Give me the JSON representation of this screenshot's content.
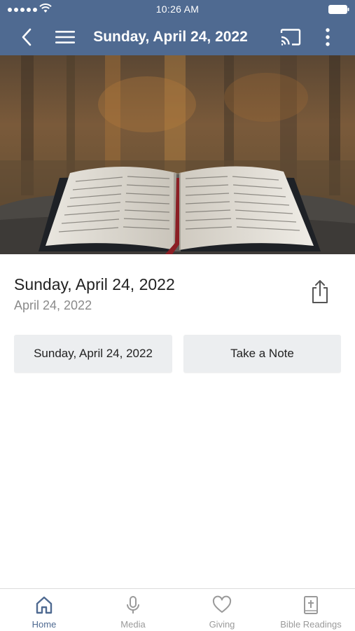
{
  "status_bar": {
    "time": "10:26 AM"
  },
  "nav": {
    "title": "Sunday, April 24, 2022",
    "back_icon": "chevron-left-icon",
    "menu_icon": "hamburger-menu-icon",
    "cast_icon": "cast-icon",
    "more_icon": "vertical-dots-icon"
  },
  "hero": {
    "description_icon": "open-bible-photo"
  },
  "content": {
    "title": "Sunday, April 24, 2022",
    "date": "April 24, 2022",
    "share_icon": "share-icon"
  },
  "actions": [
    {
      "label": "Sunday, April 24, 2022"
    },
    {
      "label": "Take a Note"
    }
  ],
  "tabs": [
    {
      "label": "Home",
      "icon": "home-icon",
      "active": true
    },
    {
      "label": "Media",
      "icon": "microphone-icon",
      "active": false
    },
    {
      "label": "Giving",
      "icon": "heart-icon",
      "active": false
    },
    {
      "label": "Bible Readings",
      "icon": "bible-icon",
      "active": false
    }
  ],
  "colors": {
    "header_bg": "#4f6a91",
    "active_tab": "#4f6a91",
    "inactive_tab": "#9a9a9a",
    "button_bg": "#eceef0"
  }
}
